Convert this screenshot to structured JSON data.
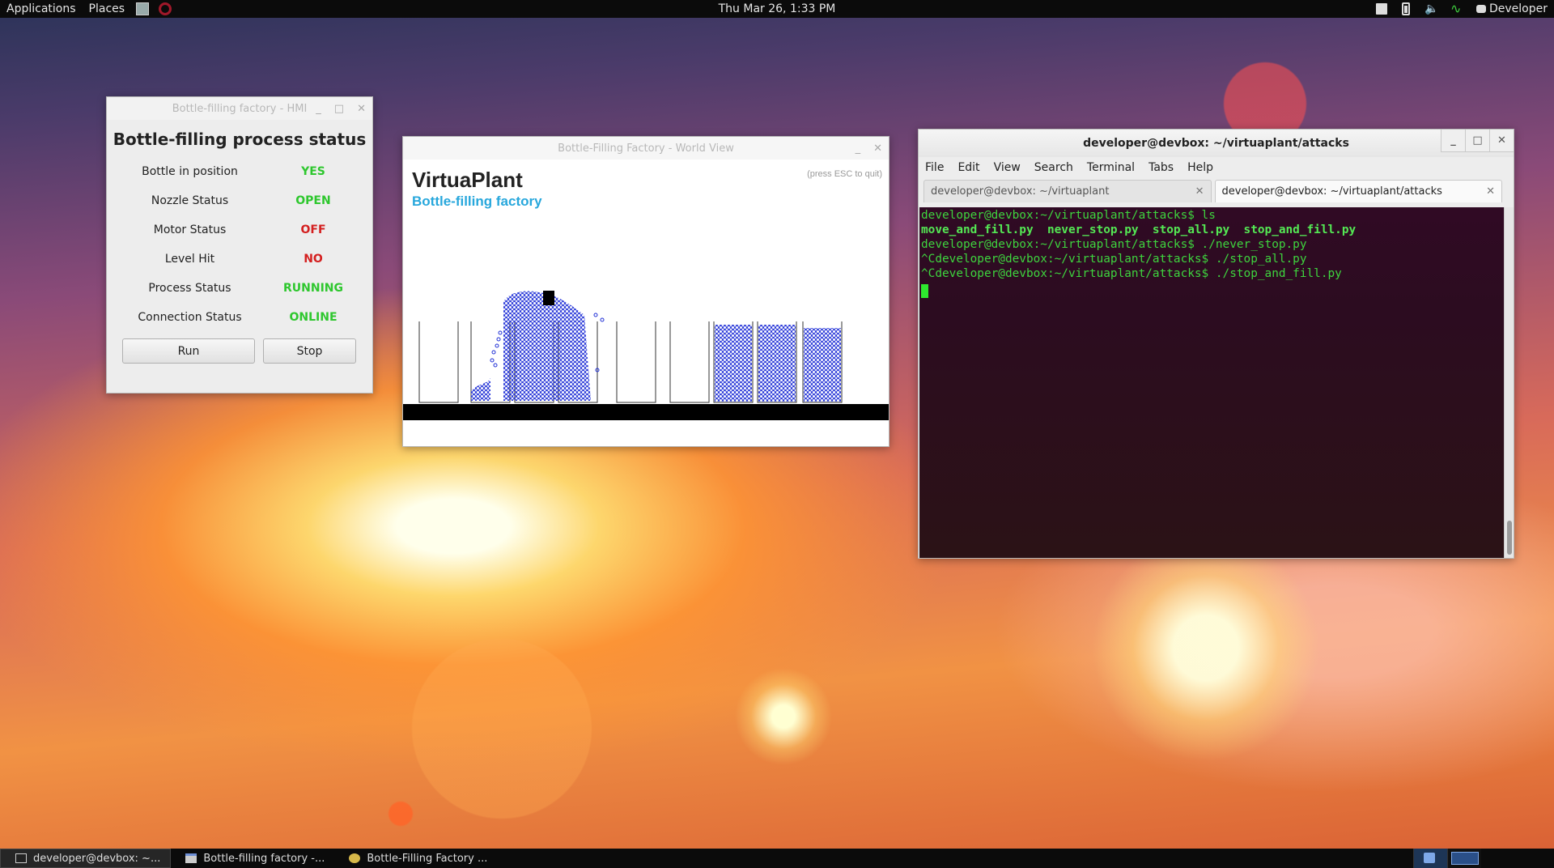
{
  "top_panel": {
    "applications": "Applications",
    "places": "Places",
    "clock": "Thu Mar 26,  1:33 PM",
    "user": "Developer"
  },
  "hmi": {
    "window_title": "Bottle-filling factory - HMI",
    "heading": "Bottle-filling process status",
    "rows": [
      {
        "label": "Bottle in position",
        "value": "YES",
        "color": "#2ec72e"
      },
      {
        "label": "Nozzle Status",
        "value": "OPEN",
        "color": "#2ec72e"
      },
      {
        "label": "Motor Status",
        "value": "OFF",
        "color": "#d42020"
      },
      {
        "label": "Level Hit",
        "value": "NO",
        "color": "#d42020"
      },
      {
        "label": "Process Status",
        "value": "RUNNING",
        "color": "#2ec72e"
      },
      {
        "label": "Connection Status",
        "value": "ONLINE",
        "color": "#2ec72e"
      }
    ],
    "run_label": "Run",
    "stop_label": "Stop"
  },
  "world_view": {
    "window_title": "Bottle-Filling Factory - World View",
    "title": "VirtuaPlant",
    "subtitle": "Bottle-filling factory",
    "hint": "(press ESC to quit)",
    "colors": {
      "liquid": "#1f2fd6",
      "conveyor": "#000000",
      "accent": "#27a7dc"
    }
  },
  "terminal": {
    "window_title": "developer@devbox: ~/virtuaplant/attacks",
    "menu": [
      "File",
      "Edit",
      "View",
      "Search",
      "Terminal",
      "Tabs",
      "Help"
    ],
    "tabs": [
      {
        "label": "developer@devbox: ~/virtuaplant"
      },
      {
        "label": "developer@devbox: ~/virtuaplant/attacks"
      }
    ],
    "lines": [
      "developer@devbox:~/virtuaplant/attacks$ ls",
      "move_and_fill.py  never_stop.py  stop_all.py  stop_and_fill.py",
      "developer@devbox:~/virtuaplant/attacks$ ./never_stop.py",
      "^Cdeveloper@devbox:~/virtuaplant/attacks$ ./stop_all.py",
      "^Cdeveloper@devbox:~/virtuaplant/attacks$ ./stop_and_fill.py"
    ],
    "colors": {
      "text": "#3ed43e",
      "background": "#300a24"
    }
  },
  "taskbar": {
    "items": [
      {
        "label": "developer@devbox: ~..."
      },
      {
        "label": "Bottle-filling factory -..."
      },
      {
        "label": "Bottle-Filling Factory ..."
      }
    ]
  }
}
